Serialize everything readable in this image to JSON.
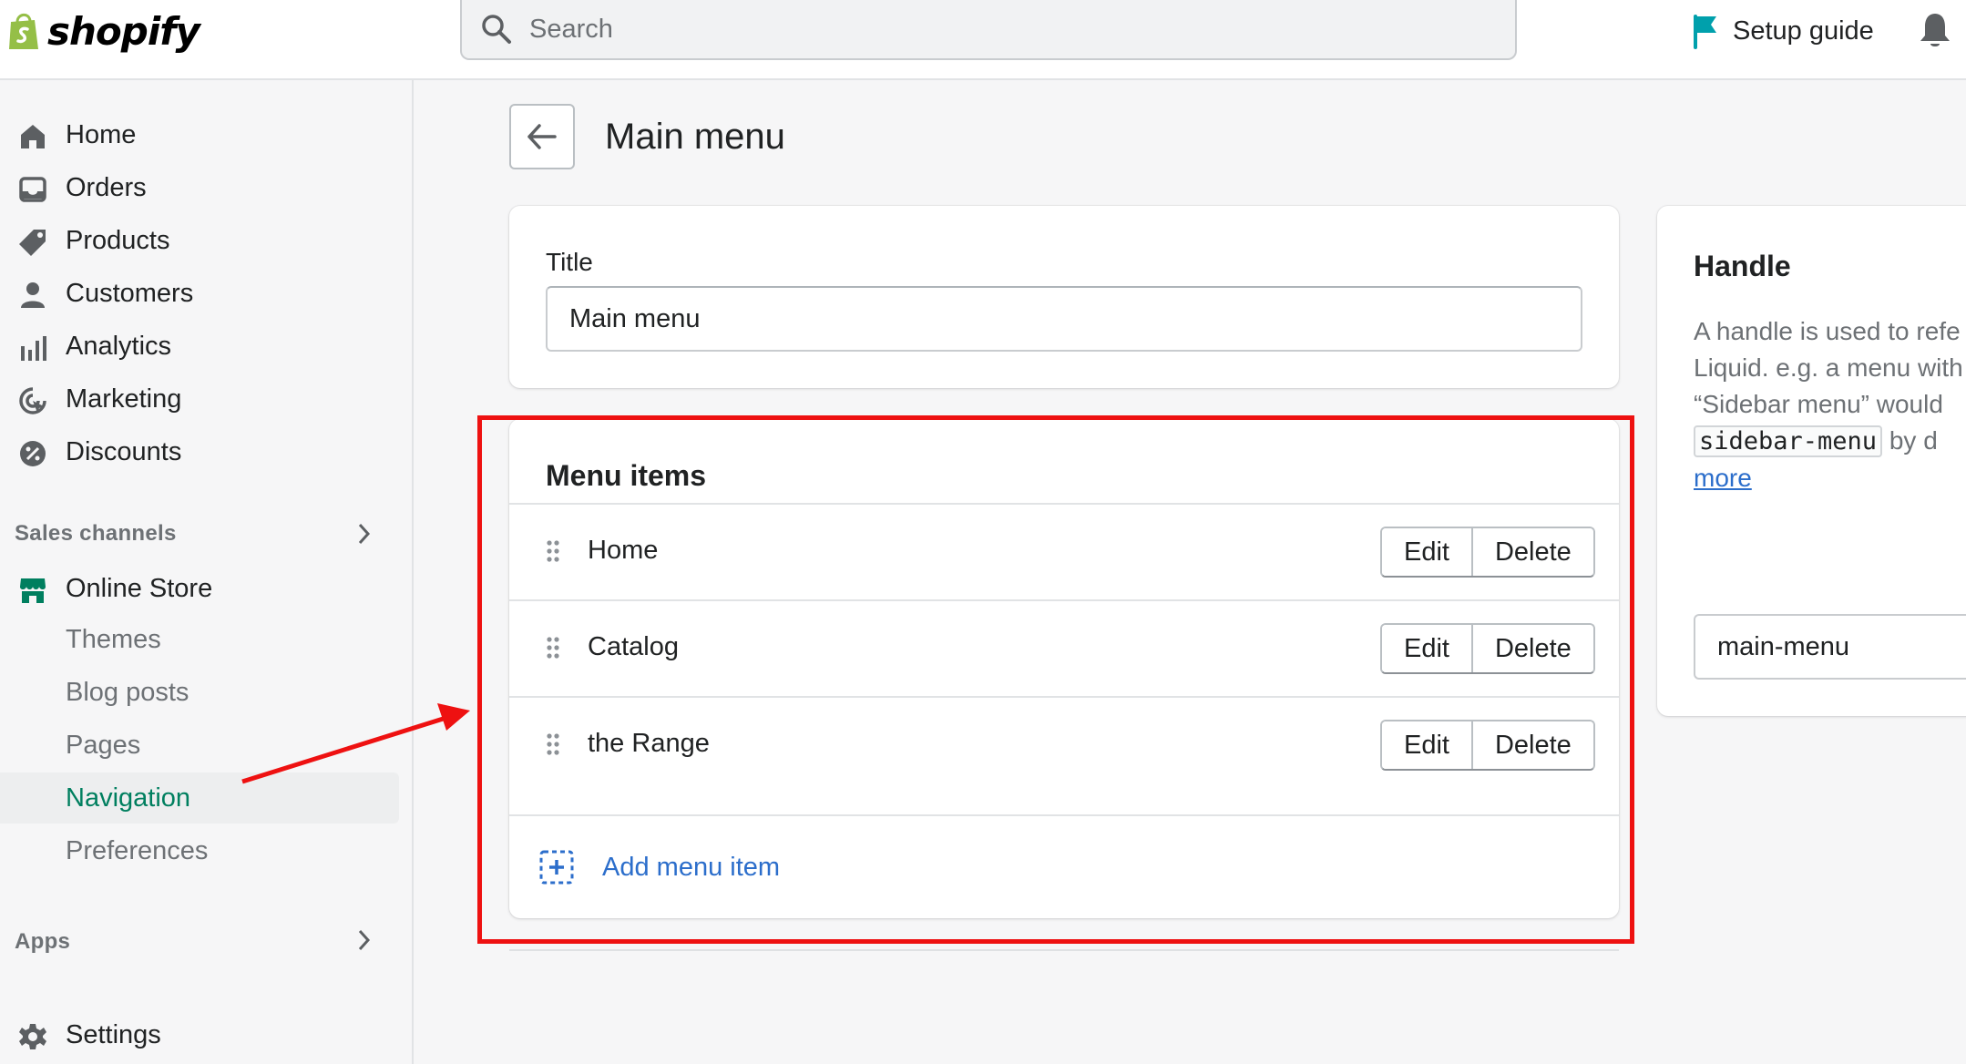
{
  "brand": {
    "name": "shopify",
    "logo_color": "#95bf47"
  },
  "search": {
    "placeholder": "Search"
  },
  "topbar": {
    "setup_guide_label": "Setup guide",
    "setup_icon": "flag-icon",
    "notification_icon": "bell-icon"
  },
  "sidebar": {
    "items": [
      {
        "label": "Home",
        "icon": "home-icon"
      },
      {
        "label": "Orders",
        "icon": "orders-inbox-icon"
      },
      {
        "label": "Products",
        "icon": "tag-icon"
      },
      {
        "label": "Customers",
        "icon": "person-icon"
      },
      {
        "label": "Analytics",
        "icon": "bar-chart-icon"
      },
      {
        "label": "Marketing",
        "icon": "target-icon"
      },
      {
        "label": "Discounts",
        "icon": "discount-badge-icon"
      }
    ],
    "sales_channels_label": "Sales channels",
    "online_store": {
      "label": "Online Store",
      "icon": "store-icon",
      "subitems": [
        "Themes",
        "Blog posts",
        "Pages",
        "Navigation",
        "Preferences"
      ],
      "active_subitem": "Navigation"
    },
    "apps_label": "Apps",
    "settings_label": "Settings",
    "accent_color": "#007f5f"
  },
  "page": {
    "title": "Main menu"
  },
  "title_card": {
    "label": "Title",
    "value": "Main menu"
  },
  "menu_items_card": {
    "heading": "Menu items",
    "items": [
      {
        "label": "Home",
        "edit": "Edit",
        "delete": "Delete"
      },
      {
        "label": "Catalog",
        "edit": "Edit",
        "delete": "Delete"
      },
      {
        "label": "the Range",
        "edit": "Edit",
        "delete": "Delete"
      }
    ],
    "add_label": "Add menu item"
  },
  "handle_card": {
    "title": "Handle",
    "desc_line1": "A handle is used to refe",
    "desc_line2": "Liquid. e.g. a menu with",
    "desc_line3": "“Sidebar menu” would",
    "code": "sidebar-menu",
    "desc_after_code": " by d",
    "learn_more": "more",
    "value": "main-menu"
  },
  "annotation": {
    "color": "#ee1111"
  }
}
